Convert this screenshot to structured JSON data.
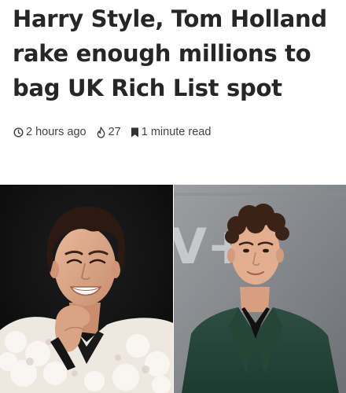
{
  "article": {
    "headline": "Harry Style, Tom Holland rake enough millions to bag UK Rich List spot",
    "meta": {
      "published": "2 hours ago",
      "views": "27",
      "read_time": "1 minute read"
    },
    "icons": {
      "published": "clock-icon",
      "views": "fire-icon",
      "read_time": "bookmark-icon"
    },
    "images": {
      "left": "photo-harry-styles",
      "right": "photo-tom-holland",
      "backdrop_sign": "V+"
    }
  }
}
